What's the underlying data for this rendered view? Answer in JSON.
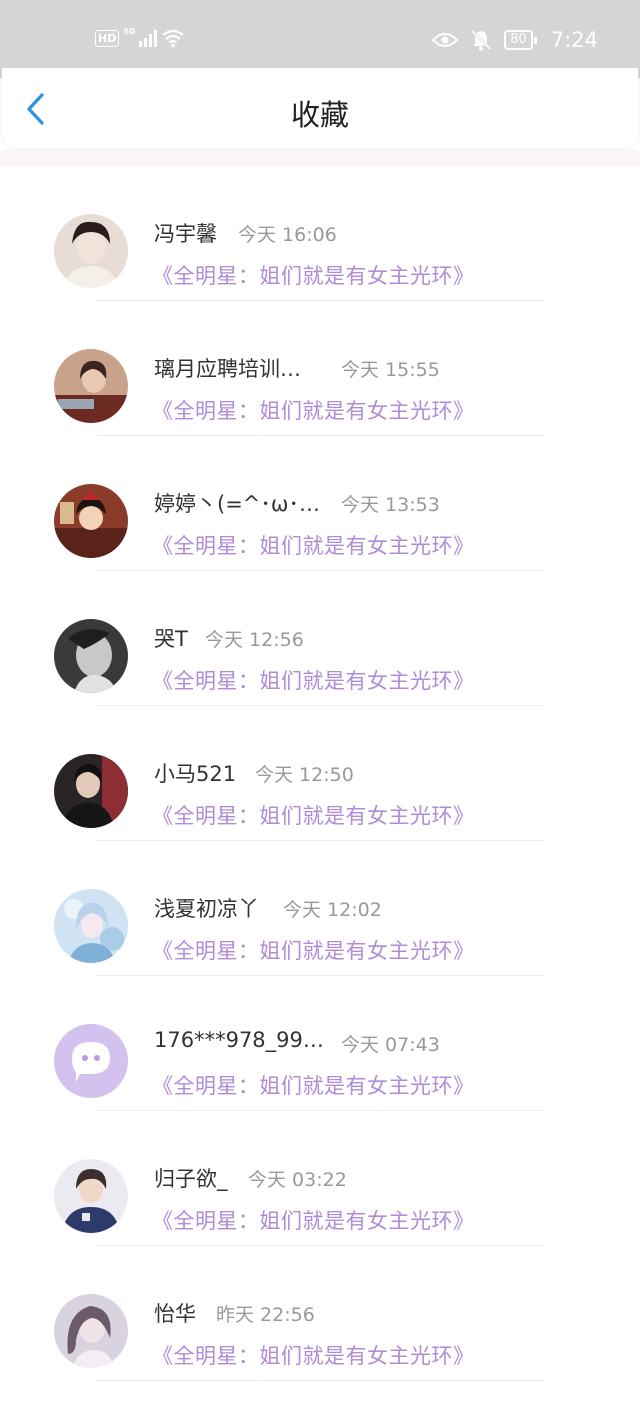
{
  "status_bar": {
    "hd_badge": "HD",
    "network": "5G",
    "battery": "80",
    "time": "7:24"
  },
  "header": {
    "title": "收藏"
  },
  "items": [
    {
      "name": "冯宇馨",
      "time": "今天 16:06",
      "subject": "《全明星：姐们就是有女主光环》"
    },
    {
      "name": "璃月应聘培训…",
      "time": "今天 15:55",
      "subject": "《全明星：姐们就是有女主光环》"
    },
    {
      "name": "婷婷丶(=^･ω･…",
      "time": "今天 13:53",
      "subject": "《全明星：姐们就是有女主光环》"
    },
    {
      "name": "哭T",
      "time": "今天 12:56",
      "subject": "《全明星：姐们就是有女主光环》"
    },
    {
      "name": "小马521",
      "time": "今天 12:50",
      "subject": "《全明星：姐们就是有女主光环》"
    },
    {
      "name": "浅夏初凉丫",
      "time": "今天 12:02",
      "subject": "《全明星：姐们就是有女主光环》"
    },
    {
      "name": "176***978_99…",
      "time": "今天 07:43",
      "subject": "《全明星：姐们就是有女主光环》"
    },
    {
      "name": "归子欲_",
      "time": "今天 03:22",
      "subject": "《全明星：姐们就是有女主光环》"
    },
    {
      "name": "怡华",
      "time": "昨天 22:56",
      "subject": "《全明星：姐们就是有女主光环》"
    }
  ],
  "colors": {
    "accent_blue": "#2f8fe0",
    "subject_purple": "#b08bd6",
    "status_bar_bg": "#d5d5d5"
  }
}
